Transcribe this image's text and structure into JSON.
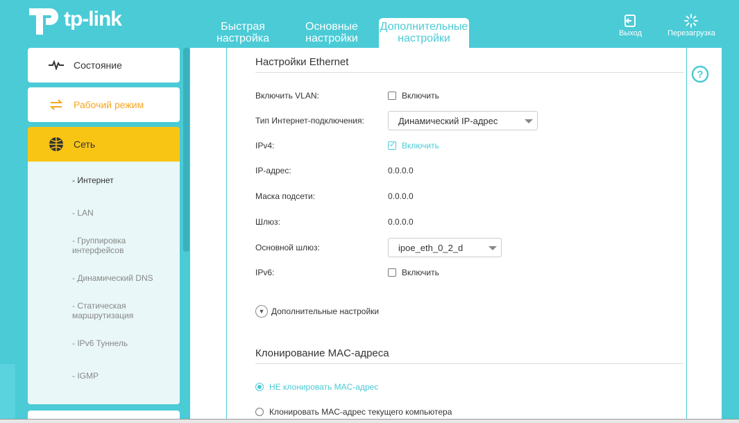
{
  "brand": {
    "logo_text": "tp-link"
  },
  "tabs": [
    {
      "label": "Быстрая настройка"
    },
    {
      "label": "Основные настройки"
    },
    {
      "label": "Дополнительные настройки"
    }
  ],
  "header": {
    "logout_label": "Выход",
    "reboot_label": "Перезагрузка"
  },
  "sidebar": {
    "items": [
      {
        "label": "Состояние",
        "icon": "pulse-icon"
      },
      {
        "label": "Рабочий режим",
        "icon": "swap-icon"
      },
      {
        "label": "Сеть",
        "icon": "globe-icon"
      }
    ],
    "sub_items": [
      {
        "label": "- Интернет"
      },
      {
        "label": "- LAN"
      },
      {
        "label": "- Группировка интерфейсов"
      },
      {
        "label": "- Динамический DNS"
      },
      {
        "label": "- Статическая маршрутизация"
      },
      {
        "label": "- IPv6 Туннель"
      },
      {
        "label": "- IGMP"
      }
    ]
  },
  "ethernet": {
    "title": "Настройки Ethernet",
    "vlan_label": "Включить VLAN:",
    "vlan_checkbox": "Включить",
    "conn_type_label": "Тип Интернет-подключения:",
    "conn_type_value": "Динамический IP-адрес",
    "ipv4_label": "IPv4:",
    "ipv4_checkbox": "Включить",
    "ip_label": "IP-адрес:",
    "ip_value": "0.0.0.0",
    "mask_label": "Маска подсети:",
    "mask_value": "0.0.0.0",
    "gateway_label": "Шлюз:",
    "gateway_value": "0.0.0.0",
    "default_gw_label": "Основной шлюз:",
    "default_gw_value": "ipoe_eth_0_2_d",
    "ipv6_label": "IPv6:",
    "ipv6_checkbox": "Включить",
    "advanced_label": "Дополнительные настройки"
  },
  "mac": {
    "title": "Клонирование MAC-адреса",
    "option_no_clone": "НЕ клонировать MAC-адрес",
    "option_clone": "Клонировать MAC-адрес текущего компьютера"
  },
  "colors": {
    "accent": "#4acbd6",
    "active_nav": "#f9c515",
    "orange": "#f5a623"
  }
}
